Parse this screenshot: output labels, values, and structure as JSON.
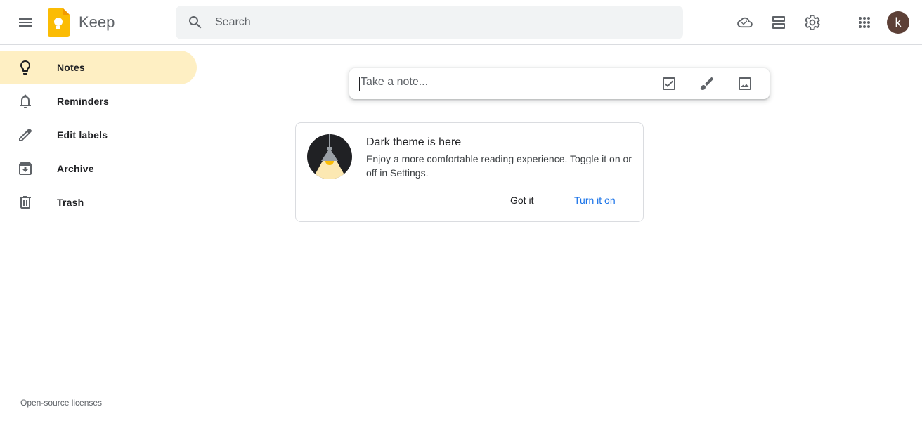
{
  "header": {
    "app_name": "Keep",
    "search_placeholder": "Search",
    "avatar_letter": "k",
    "icons": [
      "main-menu-icon",
      "keep-logo",
      "search-icon",
      "cloud-sync-icon",
      "list-view-icon",
      "settings-icon",
      "apps-grid-icon"
    ]
  },
  "sidebar": {
    "items": [
      {
        "label": "Notes",
        "icon": "lightbulb-icon",
        "active": true
      },
      {
        "label": "Reminders",
        "icon": "bell-icon",
        "active": false
      },
      {
        "label": "Edit labels",
        "icon": "pencil-icon",
        "active": false
      },
      {
        "label": "Archive",
        "icon": "archive-icon",
        "active": false
      },
      {
        "label": "Trash",
        "icon": "trash-icon",
        "active": false
      }
    ],
    "footer_link": "Open-source licenses"
  },
  "note_bar": {
    "placeholder": "Take a note...",
    "tools": [
      "new-list-icon",
      "new-drawing-icon",
      "new-image-icon"
    ]
  },
  "promo": {
    "title": "Dark theme is here",
    "body": "Enjoy a more comfortable reading experience. Toggle it on or off in Settings.",
    "dismiss_label": "Got it",
    "action_label": "Turn it on"
  },
  "colors": {
    "active_nav_bg": "#feefc3",
    "link_blue": "#1a73e8",
    "avatar_bg": "#5d4037",
    "logo_yellow": "#fbbc04",
    "search_bg": "#f1f3f4"
  }
}
